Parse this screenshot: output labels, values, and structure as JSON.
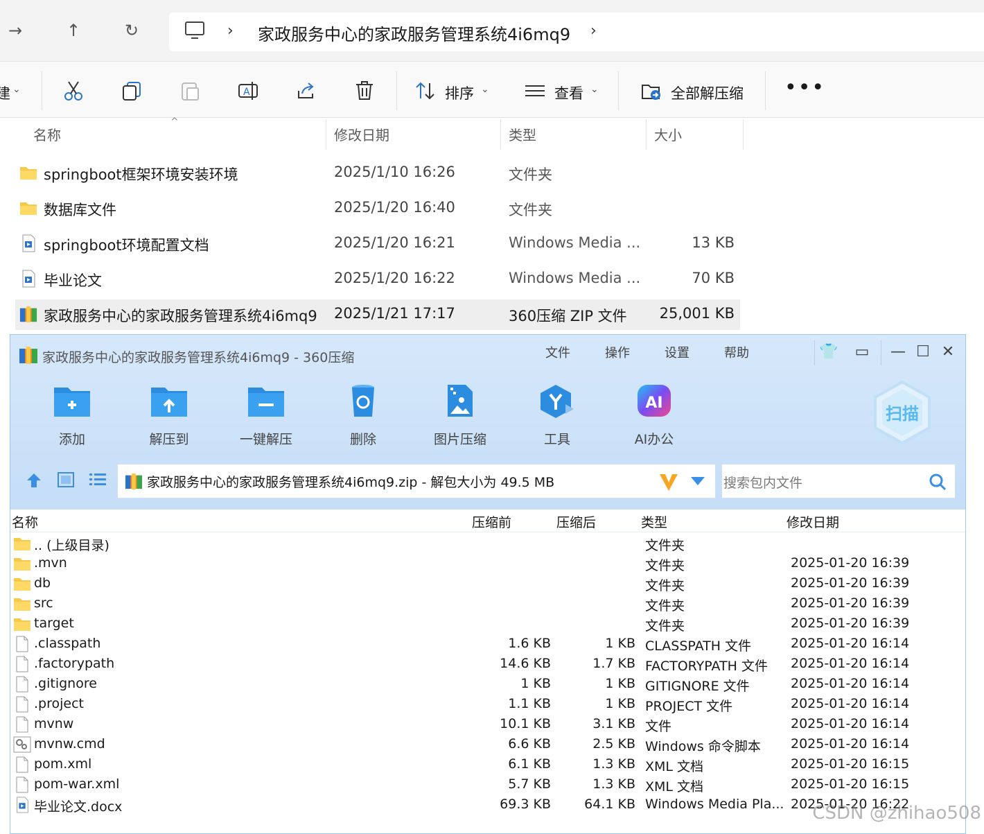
{
  "explorer": {
    "address_path": "家政服务中心的家政服务管理系统4i6mq9",
    "toolbar": {
      "sort_label": "排序",
      "view_label": "查看",
      "extract_all_label": "全部解压缩",
      "new_label_fragment": "建"
    },
    "columns": {
      "name": "名称",
      "modified": "修改日期",
      "type": "类型",
      "size": "大小"
    },
    "files": [
      {
        "name": "springboot框架环境安装环境",
        "modified": "2025/1/10 16:26",
        "type": "文件夹",
        "size": "",
        "icon": "folder-icon"
      },
      {
        "name": "数据库文件",
        "modified": "2025/1/20 16:40",
        "type": "文件夹",
        "size": "",
        "icon": "folder-icon"
      },
      {
        "name": "springboot环境配置文档",
        "modified": "2025/1/20 16:21",
        "type": "Windows Media ...",
        "size": "13 KB",
        "icon": "media-file-icon"
      },
      {
        "name": "毕业论文",
        "modified": "2025/1/20 16:22",
        "type": "Windows Media ...",
        "size": "70 KB",
        "icon": "media-file-icon"
      },
      {
        "name": "家政服务中心的家政服务管理系统4i6mq9",
        "modified": "2025/1/21 17:17",
        "type": "360压缩 ZIP 文件",
        "size": "25,001 KB",
        "icon": "zip-archive-icon",
        "selected": true
      }
    ]
  },
  "zip_window": {
    "title": "家政服务中心的家政服务管理系统4i6mq9 - 360压缩",
    "menu": [
      "文件",
      "操作",
      "设置",
      "帮助"
    ],
    "tools": [
      {
        "label": "添加",
        "icon": "add-folder-icon"
      },
      {
        "label": "解压到",
        "icon": "extract-to-icon"
      },
      {
        "label": "一键解压",
        "icon": "one-click-extract-icon"
      },
      {
        "label": "删除",
        "icon": "recycle-bin-icon"
      },
      {
        "label": "图片压缩",
        "icon": "image-compress-icon"
      },
      {
        "label": "工具",
        "icon": "tools-icon"
      },
      {
        "label": "AI办公",
        "icon": "ai-office-icon"
      }
    ],
    "ai_badge": "AI",
    "scan_label": "扫描",
    "archive_path": "家政服务中心的家政服务管理系统4i6mq9.zip - 解包大小为 49.5 MB",
    "search_placeholder": "搜索包内文件",
    "columns": {
      "name": "名称",
      "before": "压缩前",
      "after": "压缩后",
      "type": "类型",
      "modified": "修改日期"
    },
    "entries": [
      {
        "name": ".. (上级目录)",
        "before": "",
        "after": "",
        "type": "文件夹",
        "modified": "",
        "icon": "folder-icon"
      },
      {
        "name": ".mvn",
        "before": "",
        "after": "",
        "type": "文件夹",
        "modified": "2025-01-20 16:39",
        "icon": "folder-icon"
      },
      {
        "name": "db",
        "before": "",
        "after": "",
        "type": "文件夹",
        "modified": "2025-01-20 16:39",
        "icon": "folder-icon"
      },
      {
        "name": "src",
        "before": "",
        "after": "",
        "type": "文件夹",
        "modified": "2025-01-20 16:39",
        "icon": "folder-icon"
      },
      {
        "name": "target",
        "before": "",
        "after": "",
        "type": "文件夹",
        "modified": "2025-01-20 16:39",
        "icon": "folder-icon"
      },
      {
        "name": ".classpath",
        "before": "1.6 KB",
        "after": "1 KB",
        "type": "CLASSPATH 文件",
        "modified": "2025-01-20 16:14",
        "icon": "blank-file-icon"
      },
      {
        "name": ".factorypath",
        "before": "14.6 KB",
        "after": "1.7 KB",
        "type": "FACTORYPATH 文件",
        "modified": "2025-01-20 16:14",
        "icon": "blank-file-icon"
      },
      {
        "name": ".gitignore",
        "before": "1 KB",
        "after": "1 KB",
        "type": "GITIGNORE 文件",
        "modified": "2025-01-20 16:14",
        "icon": "blank-file-icon"
      },
      {
        "name": ".project",
        "before": "1.1 KB",
        "after": "1 KB",
        "type": "PROJECT 文件",
        "modified": "2025-01-20 16:14",
        "icon": "blank-file-icon"
      },
      {
        "name": "mvnw",
        "before": "10.1 KB",
        "after": "3.1 KB",
        "type": "文件",
        "modified": "2025-01-20 16:14",
        "icon": "blank-file-icon"
      },
      {
        "name": "mvnw.cmd",
        "before": "6.6 KB",
        "after": "2.5 KB",
        "type": "Windows 命令脚本",
        "modified": "2025-01-20 16:14",
        "icon": "script-file-icon"
      },
      {
        "name": "pom.xml",
        "before": "6.1 KB",
        "after": "1.3 KB",
        "type": "XML 文档",
        "modified": "2025-01-20 16:15",
        "icon": "blank-file-icon"
      },
      {
        "name": "pom-war.xml",
        "before": "5.7 KB",
        "after": "1.3 KB",
        "type": "XML 文档",
        "modified": "2025-01-20 16:15",
        "icon": "blank-file-icon"
      },
      {
        "name": "毕业论文.docx",
        "before": "69.3 KB",
        "after": "64.1 KB",
        "type": "Windows Media Pla...",
        "modified": "2025-01-20 16:22",
        "icon": "media-file-icon"
      }
    ]
  },
  "watermark": "CSDN @zhihao508",
  "colors": {
    "folder": "#f7c948",
    "zip_accent": "#2b8ce0",
    "selected_row": "#eeeeee",
    "zip_header": "#d6e8fb"
  }
}
